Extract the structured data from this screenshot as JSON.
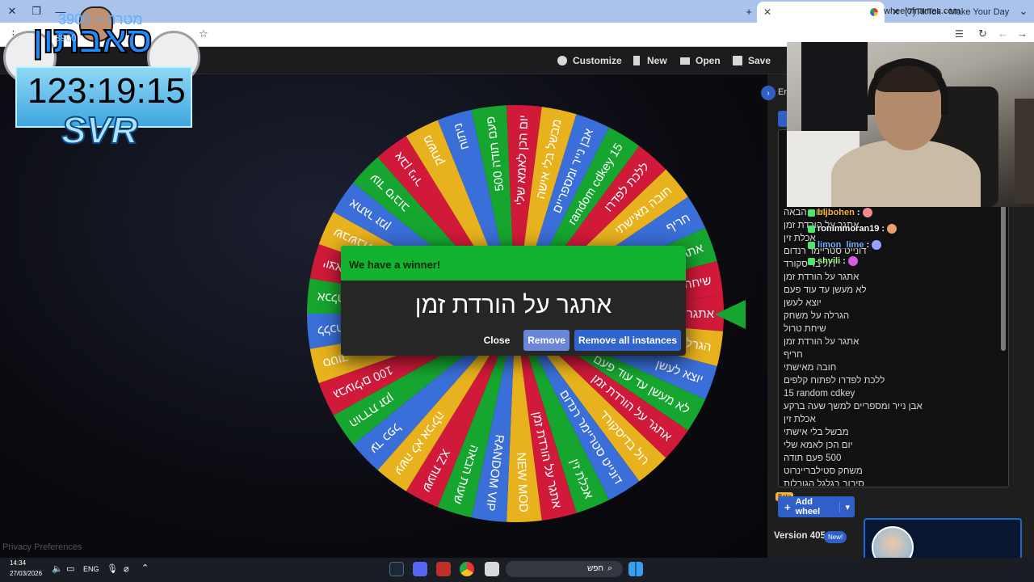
{
  "browser": {
    "active_tab_title": "",
    "tiktok_tab_title": "(7)TikTok - Make Your Day",
    "url": "wheelofnames.com"
  },
  "toolbar": {
    "customize": "Customize",
    "new": "New",
    "open": "Open",
    "save": "Save"
  },
  "wheel": {
    "colors": [
      "#d11a3a",
      "#e8b21e",
      "#3a6ed8",
      "#16a52f"
    ],
    "segments": [
      "אתגר על הורדת זמן",
      "הגרלה על משחק",
      "יוצא לעשן",
      "לא מעשן עד עוד פעם",
      "אתגר על הורדת זמן",
      "רול בדיסקורד",
      "דונייט סטריימר רנדום",
      "אכלת זין",
      "אתגר על הורדת זמן",
      "NEW MOD",
      "RANDOM VIP",
      "שעות הבאה",
      "XZ שעות",
      "עשה לא אכילה",
      "עד כפל",
      "הורדת זמן",
      "100 גבעולים",
      "סטוד",
      "ללכת עם",
      "אכלת אף",
      "יוצא",
      "שבשבת",
      "אתגר זמן",
      "עוד סיבוב",
      "אבן נייר",
      "משחק",
      "ניתוח",
      "פעם תודה 500",
      "יום הכן לאמא שלי",
      "מבשל בלי אישה",
      "אבן נייר ומספריים",
      "random cdkey 15",
      "ללכת לפדרו",
      "חובה מאישתי",
      "חריף",
      "אתגר על הורדת זמן",
      "שיחת טרול"
    ]
  },
  "winner": {
    "heading": "We have a winner!",
    "name": "אתגר על הורדת זמן",
    "close": "Close",
    "remove": "Remove",
    "remove_all": "Remove all instances"
  },
  "panel": {
    "toggle_label": "En",
    "entries": [
      "שעות הבאה",
      "אתגר על הורדת זמן",
      "אכלת זין",
      "דונייט סטריימר רנדום",
      "רול בדיסקורד",
      "אתגר על הורדת זמן",
      "לא מעשן עד עוד פעם",
      "יוצא לעשן",
      "הגרלה על משחק",
      "שיחת טרול",
      "אתגר על הורדת זמן",
      "חריף",
      "חובה מאישתי",
      "ללכת לפדרו לפתוח קלפים",
      "15 random cdkey",
      "אבן נייר ומספריים למשך שעה ברקע",
      "אכלת זין",
      "מבשל בלי אישתי",
      "יום הכן לאמא שלי",
      "500 פעם תודה",
      "משחק סטילבריינרוט",
      "סיבוב בגלגל הגורלות"
    ],
    "beta": "Beta",
    "add_wheel": "Add wheel",
    "version": "Version 405",
    "new_badge": "New!"
  },
  "privacy": "Privacy Preferences",
  "chat": [
    {
      "user": "bljbohen",
      "color": "#f5b53a"
    },
    {
      "user": "ronimmoran19",
      "color": "#ffffff"
    },
    {
      "user": "limon_lime",
      "color": "#6fb3ff"
    },
    {
      "user": "shvili",
      "color": "#a8ff8a"
    }
  ],
  "overlay": {
    "brand": "סאבתון",
    "timer": "123:19:15",
    "svr": "SVR",
    "goal_label": "מטרה – 3900",
    "goal_value": "3900"
  },
  "taskbar": {
    "time": "14:34",
    "date": "27/03/2026",
    "lang": "ENG",
    "search": "חפש"
  }
}
